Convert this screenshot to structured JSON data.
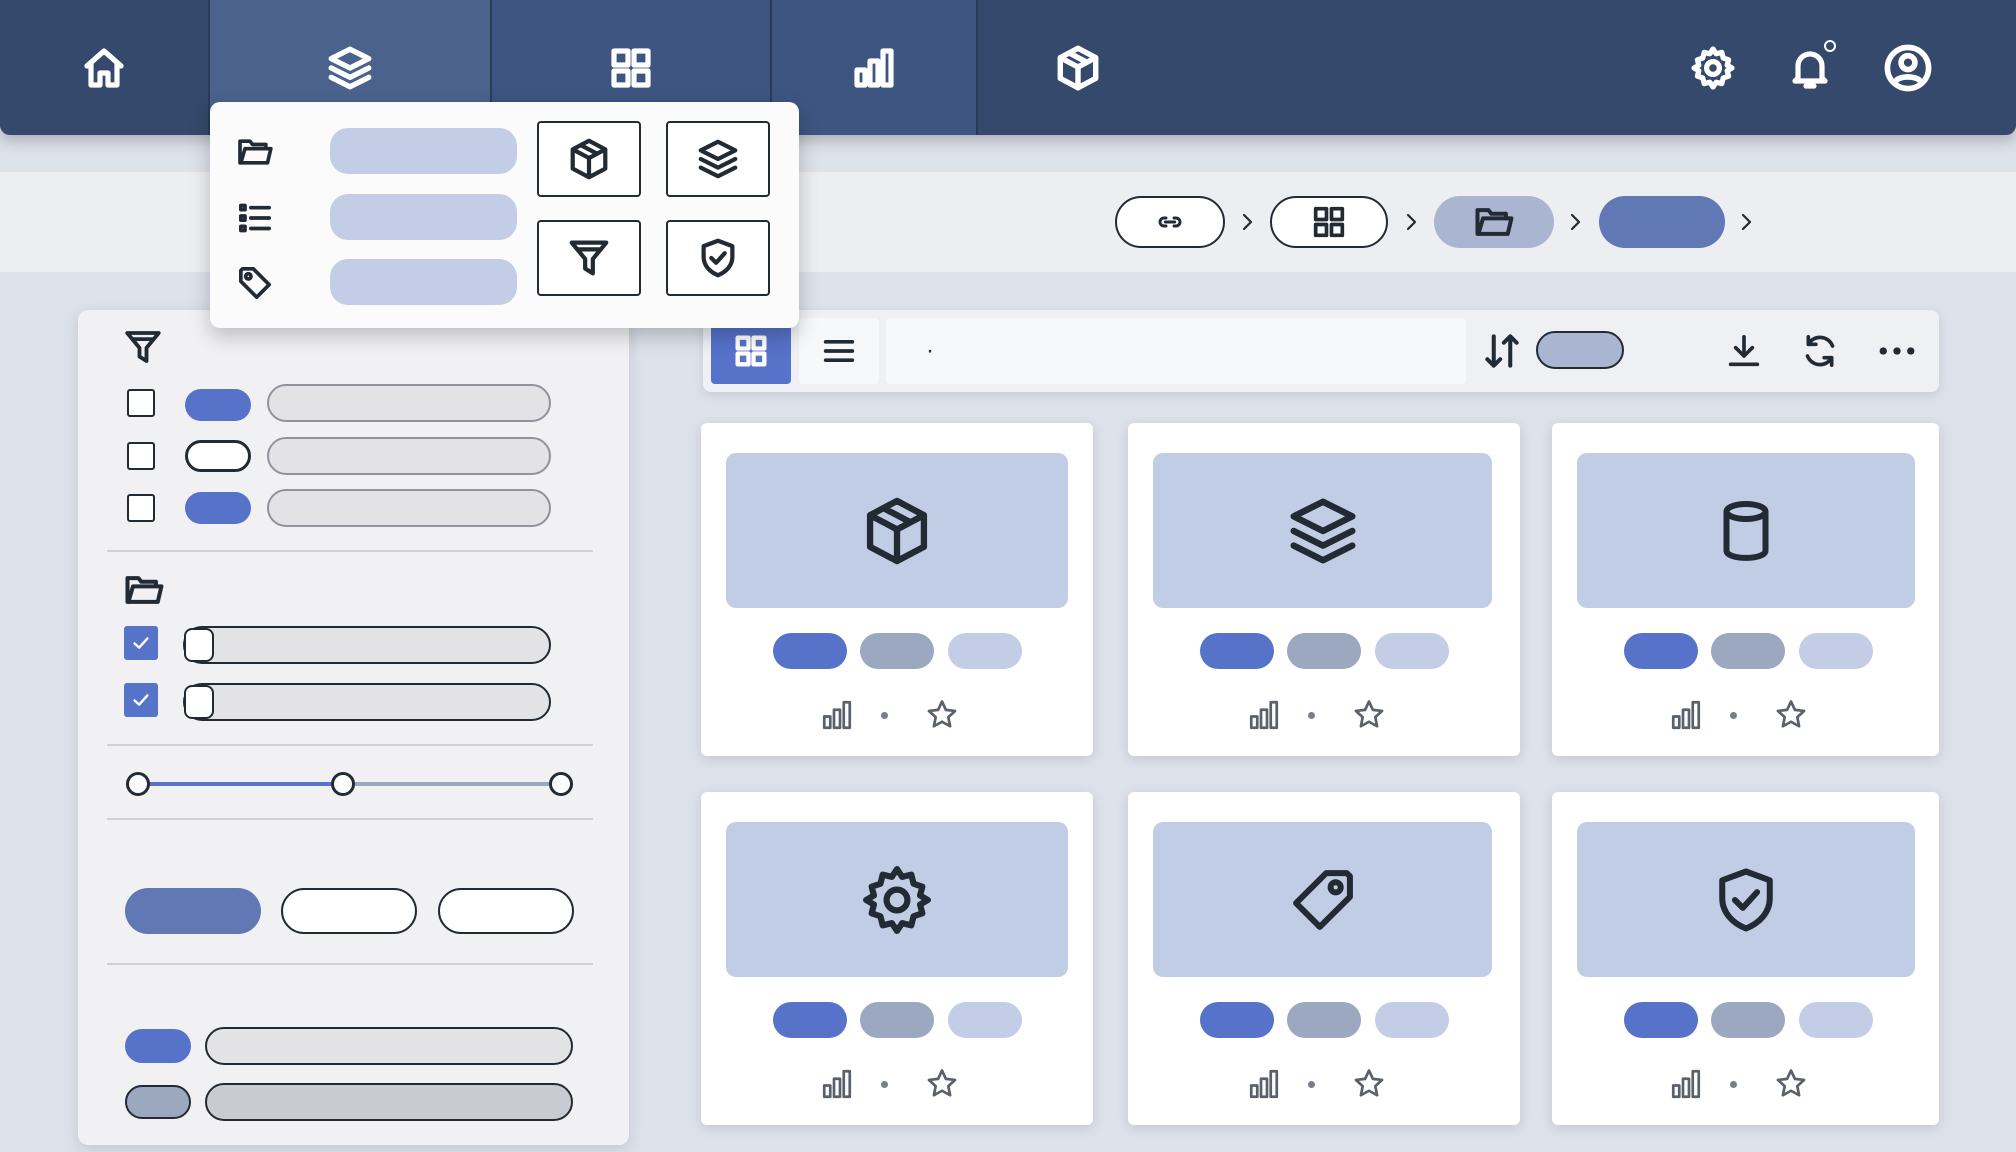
{
  "colors": {
    "nav_bg": "#34496b",
    "nav_active": "#4a628c",
    "accent_blue": "#5672c9",
    "accent_strong": "#6079b4",
    "pill_light": "#c3cde6",
    "pill_grey": "#9ba8c0",
    "thumb_bg": "#c1cce5",
    "page_bg": "#dde1ea"
  },
  "nav": {
    "tabs": [
      {
        "icon": "home-icon",
        "active": false
      },
      {
        "icon": "layers-icon",
        "active": true
      },
      {
        "icon": "grid-icon",
        "active": false
      },
      {
        "icon": "bar-chart-icon",
        "active": false
      },
      {
        "icon": "package-icon",
        "active": false
      }
    ],
    "right": [
      {
        "icon": "gear-icon"
      },
      {
        "icon": "bell-icon",
        "has_notification": true
      },
      {
        "icon": "user-icon"
      }
    ]
  },
  "menu": {
    "open": true,
    "items": [
      {
        "icon": "folder-icon"
      },
      {
        "icon": "list-icon"
      },
      {
        "icon": "tag-icon"
      }
    ],
    "tiles": [
      "package-icon",
      "layers-icon",
      "filter-icon",
      "shield-check-icon"
    ]
  },
  "breadcrumb": {
    "items": [
      {
        "icon": "link-icon",
        "style": "outline"
      },
      {
        "icon": "grid-icon",
        "style": "outline"
      },
      {
        "icon": "folder-icon",
        "style": "light"
      },
      {
        "icon": "",
        "style": "strong"
      }
    ],
    "separator": "›"
  },
  "filters": {
    "header_icon": "filter-icon",
    "group1": [
      {
        "checked": false,
        "pill": "filled"
      },
      {
        "checked": false,
        "pill": "outline"
      },
      {
        "checked": false,
        "pill": "filled"
      }
    ],
    "group2_icon": "folder-icon",
    "group2": [
      {
        "checked": true
      },
      {
        "checked": true
      }
    ],
    "slider": {
      "min": 0,
      "value": 0.5,
      "max": 1
    },
    "segments": [
      {
        "selected": true
      },
      {
        "selected": false
      },
      {
        "selected": false
      }
    ],
    "bottom_rows": [
      {
        "pill": "accent"
      },
      {
        "pill": "grey"
      }
    ]
  },
  "toolbar": {
    "view_modes": [
      "grid-icon",
      "list-icon"
    ],
    "active_view": "grid",
    "search_value": "·",
    "sort_icon": "sort-icon",
    "actions": [
      "download-icon",
      "refresh-icon",
      "more-icon"
    ]
  },
  "cards": [
    {
      "icon": "package-icon"
    },
    {
      "icon": "layers-icon"
    },
    {
      "icon": "database-icon"
    },
    {
      "icon": "gear-icon"
    },
    {
      "icon": "tag-icon"
    },
    {
      "icon": "shield-check-icon"
    }
  ],
  "card_meta": {
    "stats_icon": "bar-chart-icon",
    "favorite_icon": "star-icon"
  }
}
